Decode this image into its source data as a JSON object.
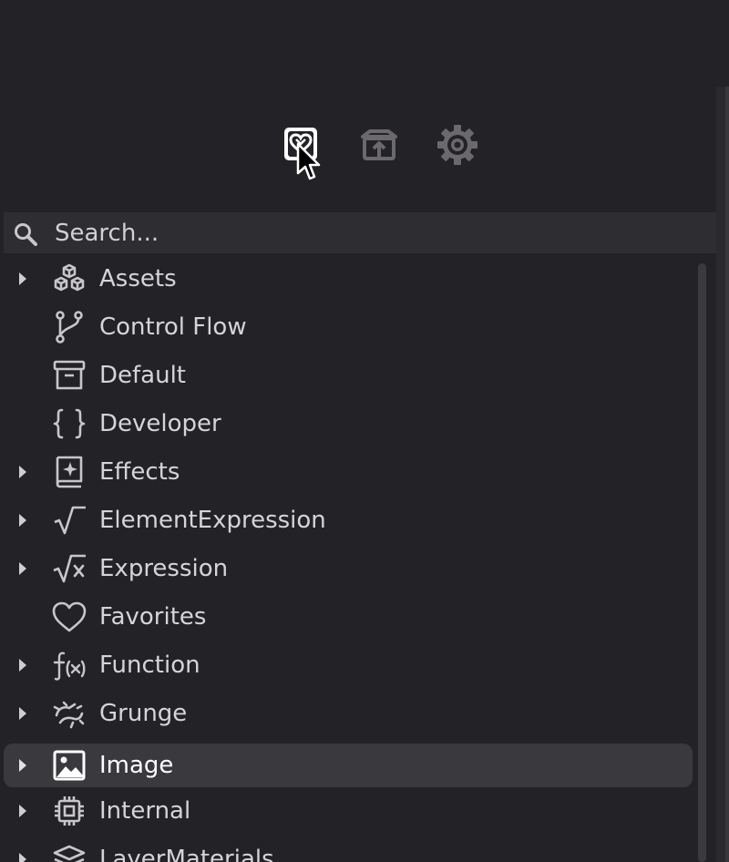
{
  "toolbar": {
    "buttons": [
      {
        "name": "library-favorites-button",
        "icon": "heart-frame-icon",
        "active": true
      },
      {
        "name": "packages-button",
        "icon": "open-box-icon",
        "active": false
      },
      {
        "name": "settings-button",
        "icon": "gear-icon",
        "active": false
      }
    ]
  },
  "search": {
    "placeholder": "Search..."
  },
  "tree": {
    "items": [
      {
        "label": "Assets",
        "icon": "cubes-icon",
        "expandable": true
      },
      {
        "label": "Control Flow",
        "icon": "branch-icon",
        "expandable": false
      },
      {
        "label": "Default",
        "icon": "archive-box-icon",
        "expandable": false
      },
      {
        "label": "Developer",
        "icon": "braces-icon",
        "expandable": false
      },
      {
        "label": "Effects",
        "icon": "sparkle-book-icon",
        "expandable": true
      },
      {
        "label": "ElementExpression",
        "icon": "square-root-icon",
        "expandable": true
      },
      {
        "label": "Expression",
        "icon": "square-root-x-icon",
        "expandable": true
      },
      {
        "label": "Favorites",
        "icon": "heart-icon",
        "expandable": false
      },
      {
        "label": "Function",
        "icon": "function-icon",
        "expandable": true
      },
      {
        "label": "Grunge",
        "icon": "grunge-icon",
        "expandable": true
      },
      {
        "label": "Image",
        "icon": "image-icon",
        "expandable": true,
        "selected": true
      },
      {
        "label": "Internal",
        "icon": "chip-icon",
        "expandable": true
      },
      {
        "label": "LayerMaterials",
        "icon": "layers-icon",
        "expandable": true
      }
    ]
  },
  "colors": {
    "background": "#232226",
    "selected_row": "#3a393e",
    "text": "#d6d4d9",
    "icon_inactive": "#6b696e"
  }
}
